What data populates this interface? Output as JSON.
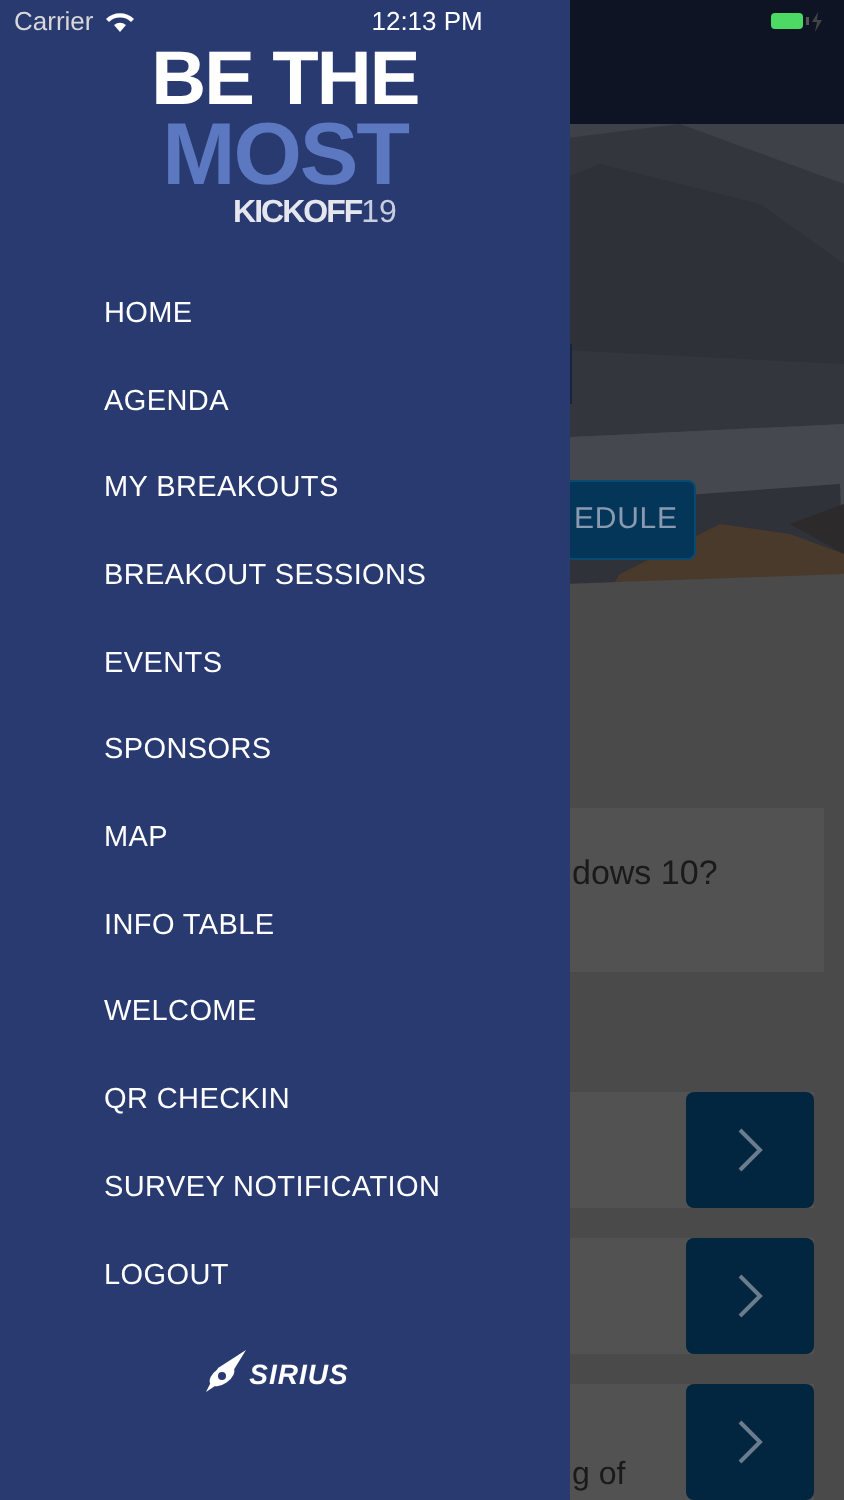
{
  "status_bar": {
    "carrier": "Carrier",
    "time": "12:13 PM"
  },
  "drawer": {
    "logo": {
      "line_1": "BE THE",
      "line_2": "MOST",
      "event": "KICKOFF",
      "year": "19"
    },
    "menu": [
      {
        "label": "HOME"
      },
      {
        "label": "AGENDA"
      },
      {
        "label": "MY BREAKOUTS"
      },
      {
        "label": "BREAKOUT SESSIONS"
      },
      {
        "label": "EVENTS"
      },
      {
        "label": "SPONSORS"
      },
      {
        "label": "MAP"
      },
      {
        "label": "INFO TABLE"
      },
      {
        "label": "WELCOME"
      },
      {
        "label": "QR CHECKIN"
      },
      {
        "label": "SURVEY NOTIFICATION"
      },
      {
        "label": "LOGOUT"
      }
    ],
    "footer_logo": "SIRIUS"
  },
  "background": {
    "schedule_button": "EDULE",
    "card_text": "dows 10?",
    "rows": [
      {},
      {},
      {
        "text": "g of"
      }
    ]
  }
}
